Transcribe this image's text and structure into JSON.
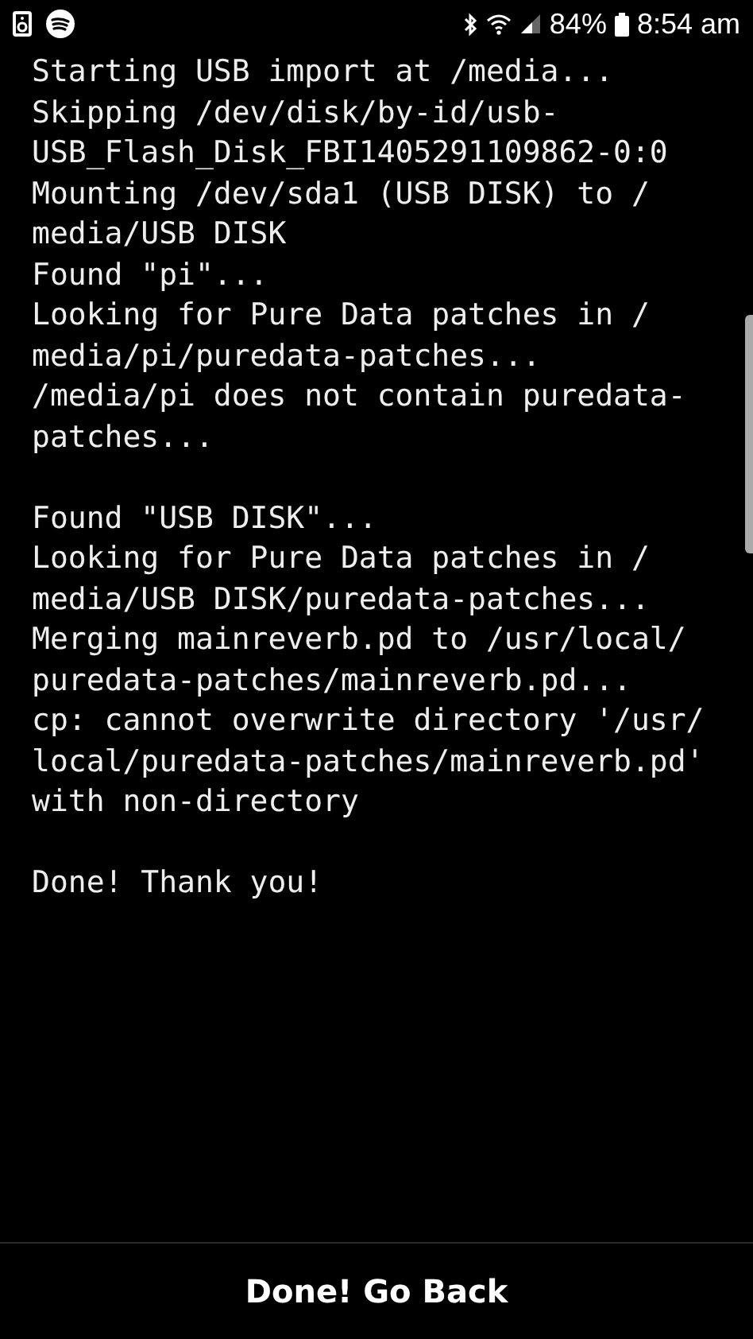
{
  "status_bar": {
    "battery": "84%",
    "time": "8:54 am"
  },
  "log": {
    "paragraphs": [
      [
        "Starting USB import at /media...",
        "Skipping /dev/disk/by-id/usb-",
        "USB_Flash_Disk_FBI1405291109862-0:0",
        "Mounting /dev/sda1 (USB DISK) to /",
        "media/USB DISK",
        "Found \"pi\"...",
        "Looking for Pure Data patches in /",
        "media/pi/puredata-patches...",
        "/media/pi does not contain puredata-",
        "patches..."
      ],
      [
        "Found \"USB DISK\"...",
        "Looking for Pure Data patches in /",
        "media/USB DISK/puredata-patches...",
        "Merging mainreverb.pd to /usr/local/",
        "puredata-patches/mainreverb.pd...",
        "cp: cannot overwrite directory '/usr/",
        "local/puredata-patches/mainreverb.pd'",
        "with non-directory"
      ],
      [
        "Done! Thank you!"
      ]
    ]
  },
  "footer": {
    "button": "Done! Go Back"
  }
}
